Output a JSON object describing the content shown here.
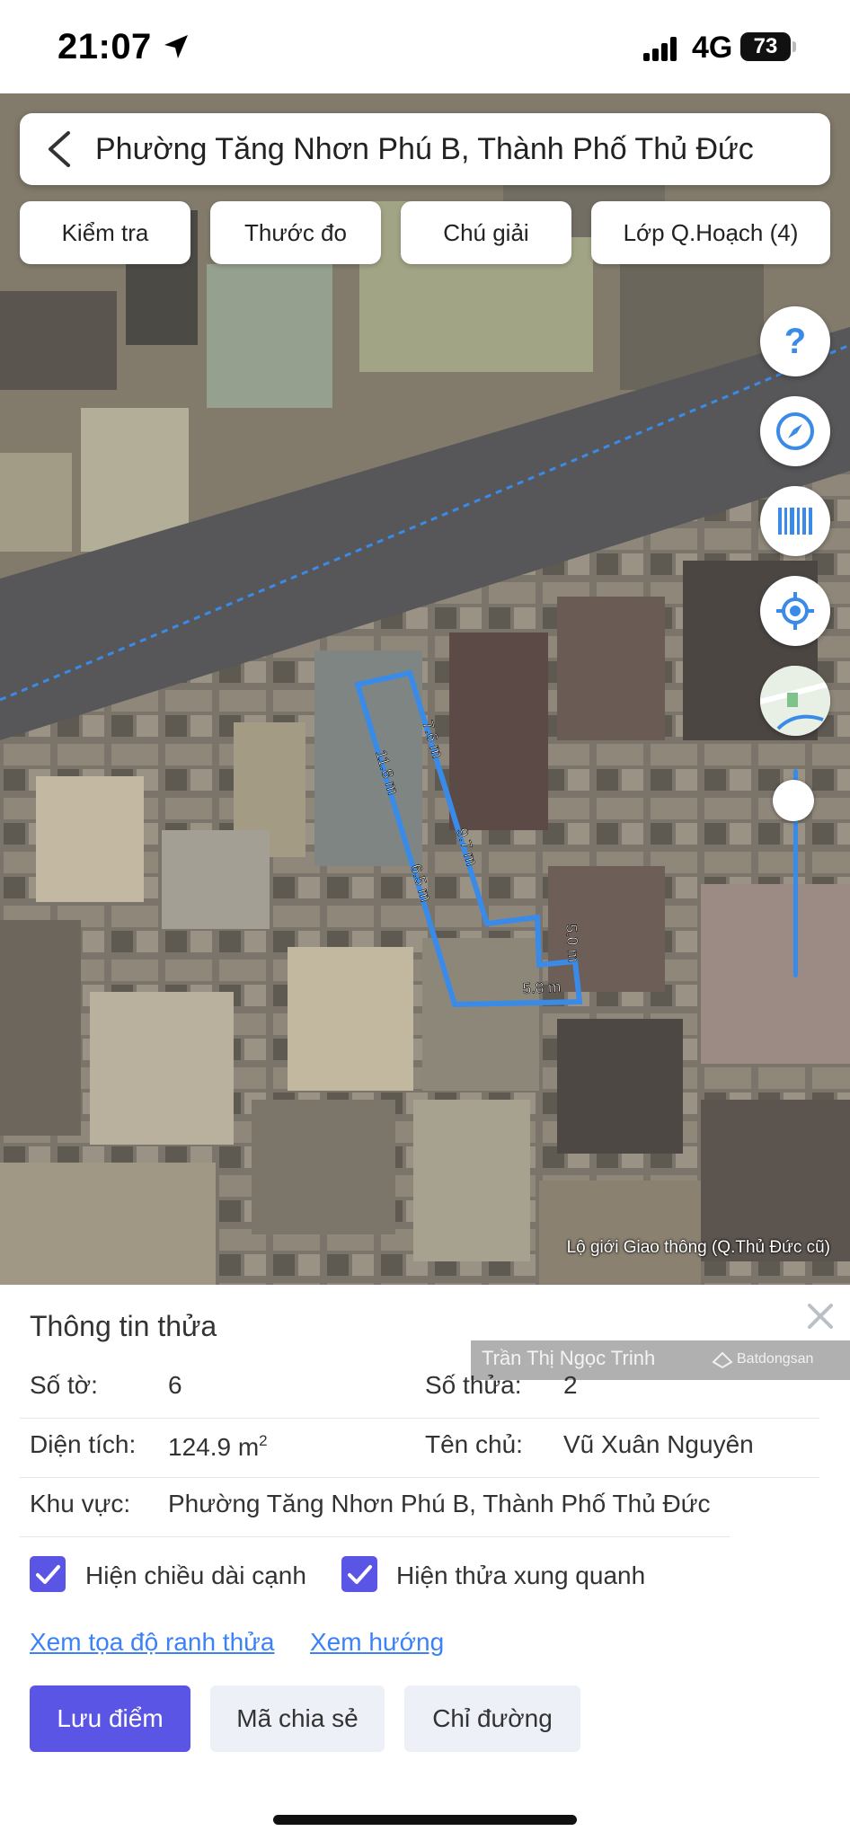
{
  "status_bar": {
    "time": "21:07",
    "network": "4G",
    "battery": "73"
  },
  "map": {
    "search_title": "Phường Tăng Nhơn Phú B, Thành Phố Thủ Đức",
    "toolbar": [
      "Kiểm tra",
      "Thước đo",
      "Chú giải",
      "Lớp Q.Hoạch (4)"
    ],
    "edge_labels": [
      "7.6 m",
      "11.8 m",
      "9.7 m",
      "6.5 m",
      "5.0 m",
      "5.8 m"
    ],
    "credit": "Lộ giới Giao thông (Q.Thủ Đức cũ)",
    "zoom_level": 0.85,
    "parcel_color": "#3a8be8",
    "icons": [
      "help-icon",
      "compass-icon",
      "barcode-icon",
      "locate-icon",
      "minimap-icon"
    ]
  },
  "panel": {
    "title": "Thông tin thửa",
    "watermark_name": "Trần Thị Ngọc Trinh",
    "watermark_brand": "Batdongsan",
    "so_to_label": "Số tờ:",
    "so_to_value": "6",
    "so_thua_label": "Số thửa:",
    "so_thua_value": "2",
    "dien_tich_label": "Diện tích:",
    "dien_tich_value": "124.9 m",
    "dien_tich_unit_sup": "2",
    "ten_chu_label": "Tên chủ:",
    "ten_chu_value": "Vũ Xuân Nguyên",
    "khu_vuc_label": "Khu vực:",
    "khu_vuc_value": "Phường Tăng Nhơn Phú B, Thành Phố Thủ Đức",
    "checkbox_edges": "Hiện chiều dài cạnh",
    "checkbox_neighbors": "Hiện thửa xung quanh",
    "link_coords": "Xem tọa độ ranh thửa",
    "link_direction": "Xem hướng",
    "btn_save": "Lưu điểm",
    "btn_share": "Mã chia sẻ",
    "btn_route": "Chỉ đường",
    "accent": "#5b55e6"
  }
}
